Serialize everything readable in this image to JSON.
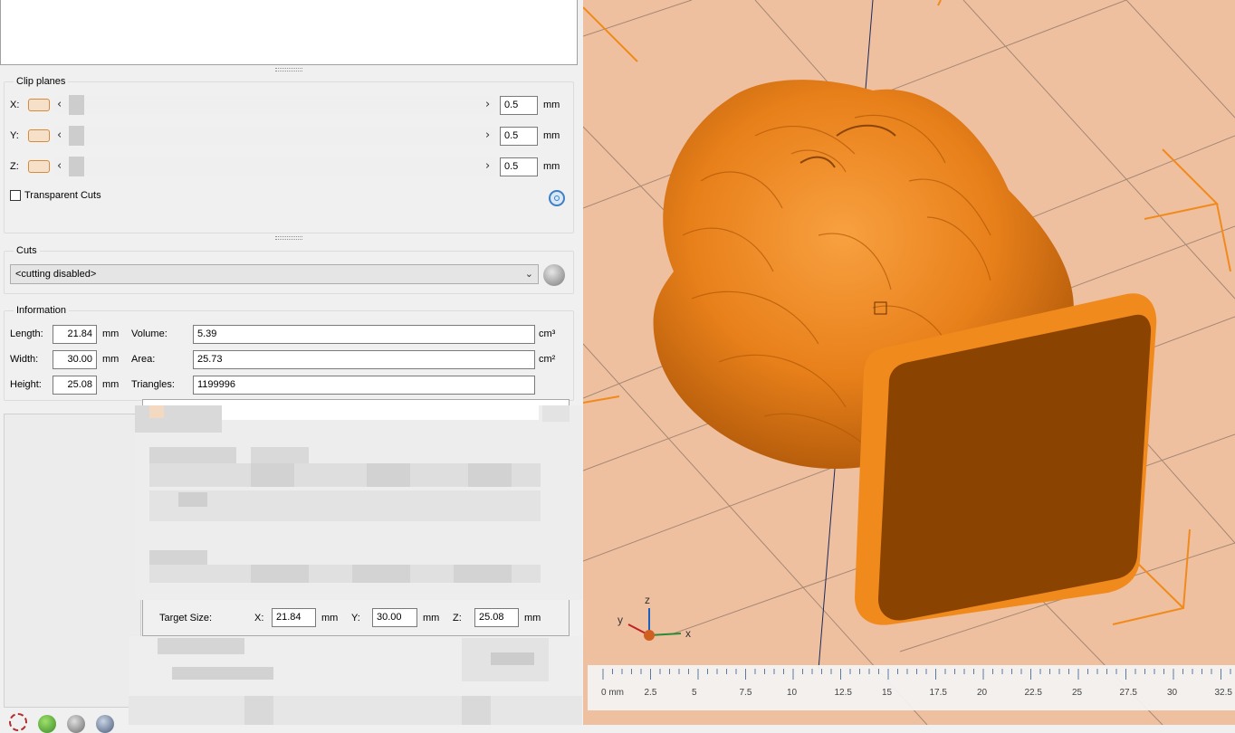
{
  "clip_planes": {
    "title": "Clip planes",
    "unit": "mm",
    "rows": [
      {
        "axis": "X:",
        "value": "0.5"
      },
      {
        "axis": "Y:",
        "value": "0.5"
      },
      {
        "axis": "Z:",
        "value": "0.5"
      }
    ],
    "transparent_cuts_label": "Transparent Cuts",
    "transparent_cuts_checked": false
  },
  "cuts": {
    "title": "Cuts",
    "selected": "<cutting disabled>"
  },
  "information": {
    "title": "Information",
    "length_label": "Length:",
    "length_value": "21.84",
    "width_label": "Width:",
    "width_value": "30.00",
    "height_label": "Height:",
    "height_value": "25.08",
    "dim_unit": "mm",
    "volume_label": "Volume:",
    "volume_value": "5.39",
    "volume_unit": "cm³",
    "area_label": "Area:",
    "area_value": "25.73",
    "area_unit": "cm²",
    "triangles_label": "Triangles:",
    "triangles_value": "1199996"
  },
  "scale_dialog": {
    "target_size_label": "Target Size:",
    "x_label": "X:",
    "x_value": "21.84",
    "y_label": "Y:",
    "y_value": "30.00",
    "z_label": "Z:",
    "z_value": "25.08",
    "unit": "mm"
  },
  "viewport": {
    "axis_labels": {
      "z": "z",
      "y": "y",
      "x": "x"
    },
    "ruler_labels": [
      "0 mm",
      "2.5",
      "5",
      "7.5",
      "10",
      "12.5",
      "15",
      "17.5",
      "20",
      "22.5",
      "25",
      "27.5",
      "30",
      "32.5"
    ],
    "model_color": "#f08a1c",
    "bed_color": "#eec0a0"
  }
}
